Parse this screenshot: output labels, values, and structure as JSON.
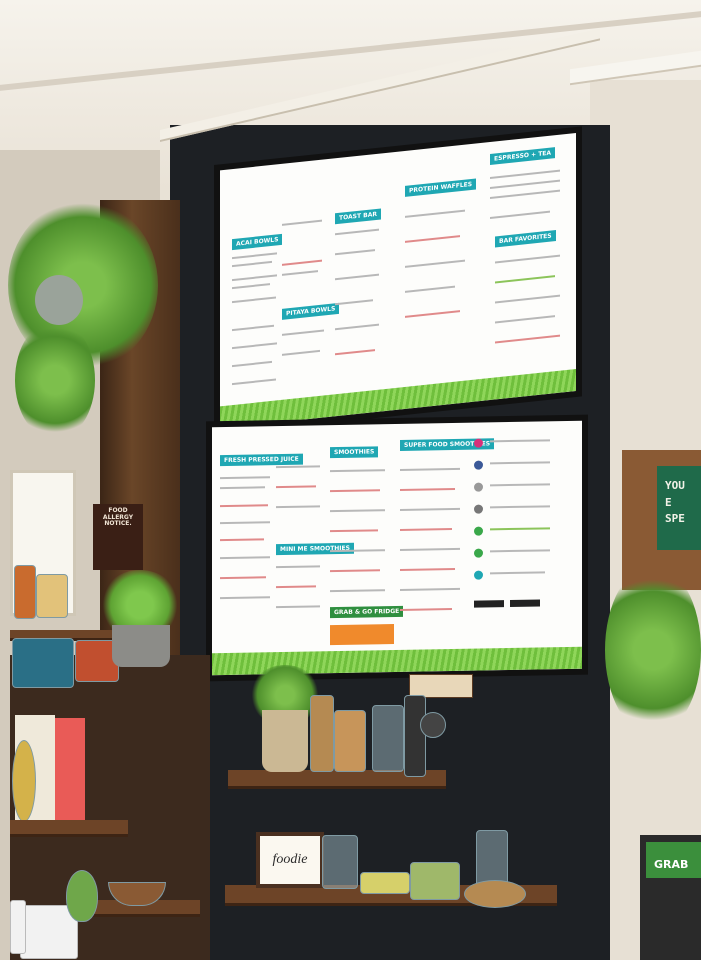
{
  "signs": {
    "allergy": [
      "FOOD",
      "ALLERGY",
      "NOTICE."
    ],
    "foodie": "foodie",
    "letter_board": [
      "YOU",
      "E",
      "SPE"
    ],
    "grab": "GRAB"
  },
  "menu_top": {
    "headers": [
      "ACAI BOWLS",
      "TOAST BAR",
      "PROTEIN WAFFLES",
      "ESPRESSO + TEA",
      "PITAYA BOWLS",
      "BAR FAVORITES"
    ]
  },
  "menu_bottom": {
    "headers": [
      "FRESH PRESSED JUICE",
      "SMOOTHIES",
      "SUPER FOOD SMOOTHIES",
      "MINI ME SMOOTHIES",
      "GRAB & GO FRIDGE"
    ]
  },
  "colors": {
    "menu_accent": "#1fa7b3",
    "grass": "#6fbf3c",
    "wall_dark": "#1d2024",
    "wood": "#6a4628",
    "orange": "#f08a2c"
  }
}
